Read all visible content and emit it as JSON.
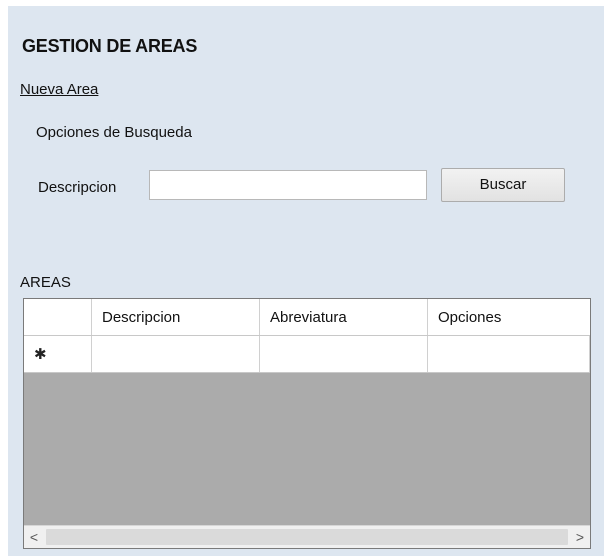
{
  "form": {
    "title": "GESTION DE AREAS",
    "new_link": "Nueva Area",
    "search_group": "Opciones de Busqueda",
    "description_label": "Descripcion",
    "description_value": "",
    "search_button": "Buscar"
  },
  "grid": {
    "label": "AREAS",
    "columns": [
      "Descripcion",
      "Abreviatura",
      "Opciones"
    ],
    "new_row_marker": "✱",
    "scroll_left_icon": "chevron-left-icon",
    "scroll_right_icon": "chevron-right-icon",
    "scroll_left_glyph": "<",
    "scroll_right_glyph": ">"
  },
  "colors": {
    "form_background": "#dde6f0",
    "grid_background": "#ababab"
  }
}
